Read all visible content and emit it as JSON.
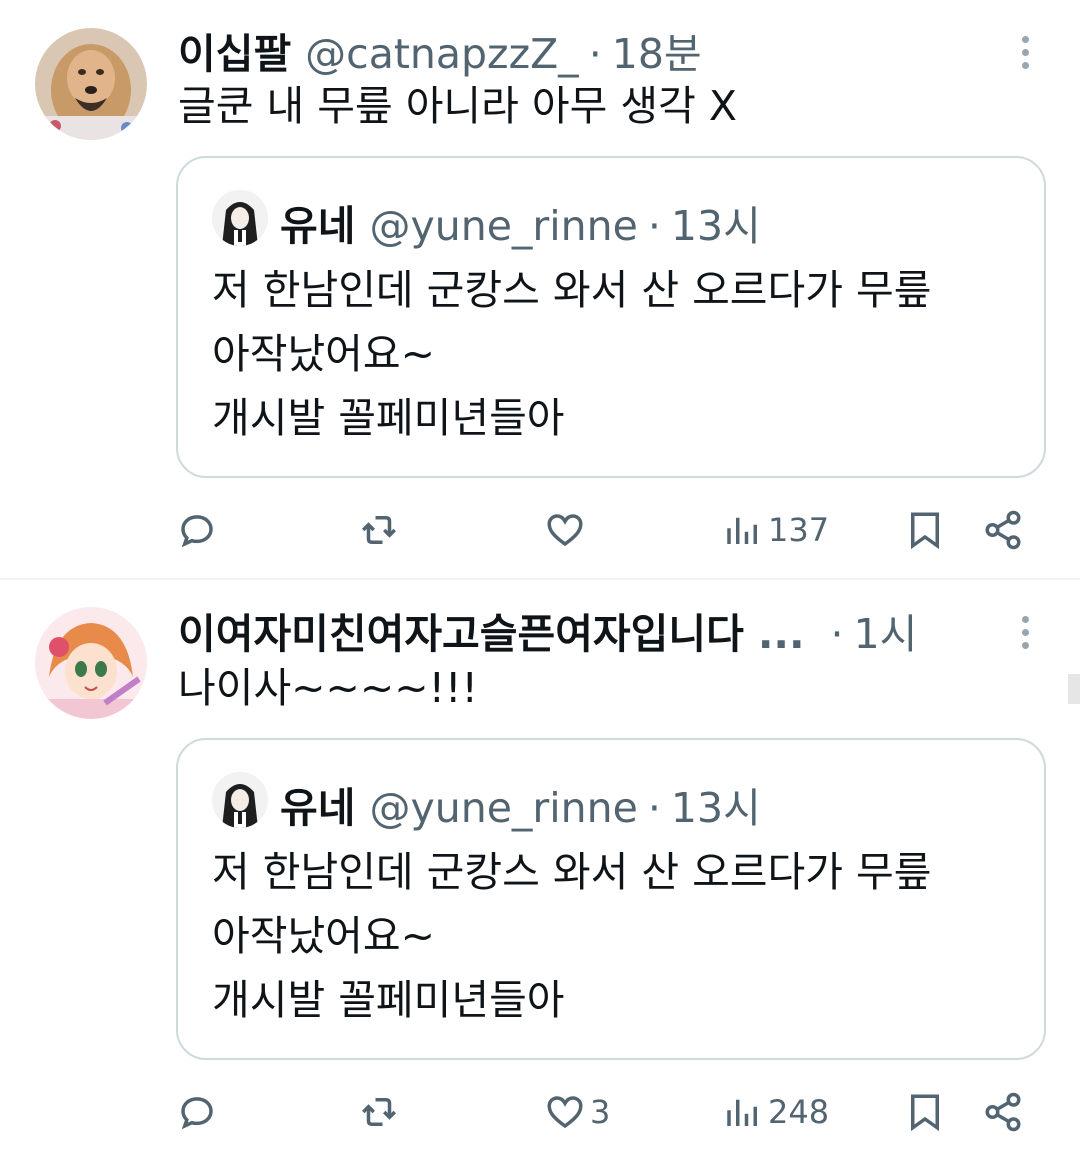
{
  "tweets": [
    {
      "author_name": "이십팔",
      "author_handle": "@catnapzzZ_",
      "separator": "·",
      "time": "18분",
      "text": "글쿤 내 무릎 아니라 아무 생각 X",
      "quote": {
        "author_name": "유네",
        "author_handle": "@yune_rinne",
        "separator": "·",
        "time": "13시",
        "lines": [
          "저 한남인데 군캉스 와서 산 오르다가 무릎",
          "아작났어요~",
          "개시발 꼴페미년들아"
        ]
      },
      "actions": {
        "reply_count": "",
        "retweet_count": "",
        "like_count": "",
        "views_count": "137"
      }
    },
    {
      "author_name": "이여자미친여자고슬픈여자입니다",
      "author_handle_truncated": "...",
      "separator": "·",
      "time": "1시",
      "text": "나이사~~~~!!!",
      "quote": {
        "author_name": "유네",
        "author_handle": "@yune_rinne",
        "separator": "·",
        "time": "13시",
        "lines": [
          "저 한남인데 군캉스 와서 산 오르다가 무릎",
          "아작났어요~",
          "개시발 꼴페미년들아"
        ]
      },
      "actions": {
        "reply_count": "",
        "retweet_count": "",
        "like_count": "3",
        "views_count": "248"
      }
    }
  ],
  "icons": {
    "reply": "reply-icon",
    "retweet": "retweet-icon",
    "like": "heart-icon",
    "views": "views-chart-icon",
    "bookmark": "bookmark-icon",
    "share": "share-icon",
    "more": "more-vertical-icon"
  },
  "colors": {
    "text_primary": "#0f1419",
    "text_secondary": "#536471",
    "border": "#cfd9de"
  }
}
